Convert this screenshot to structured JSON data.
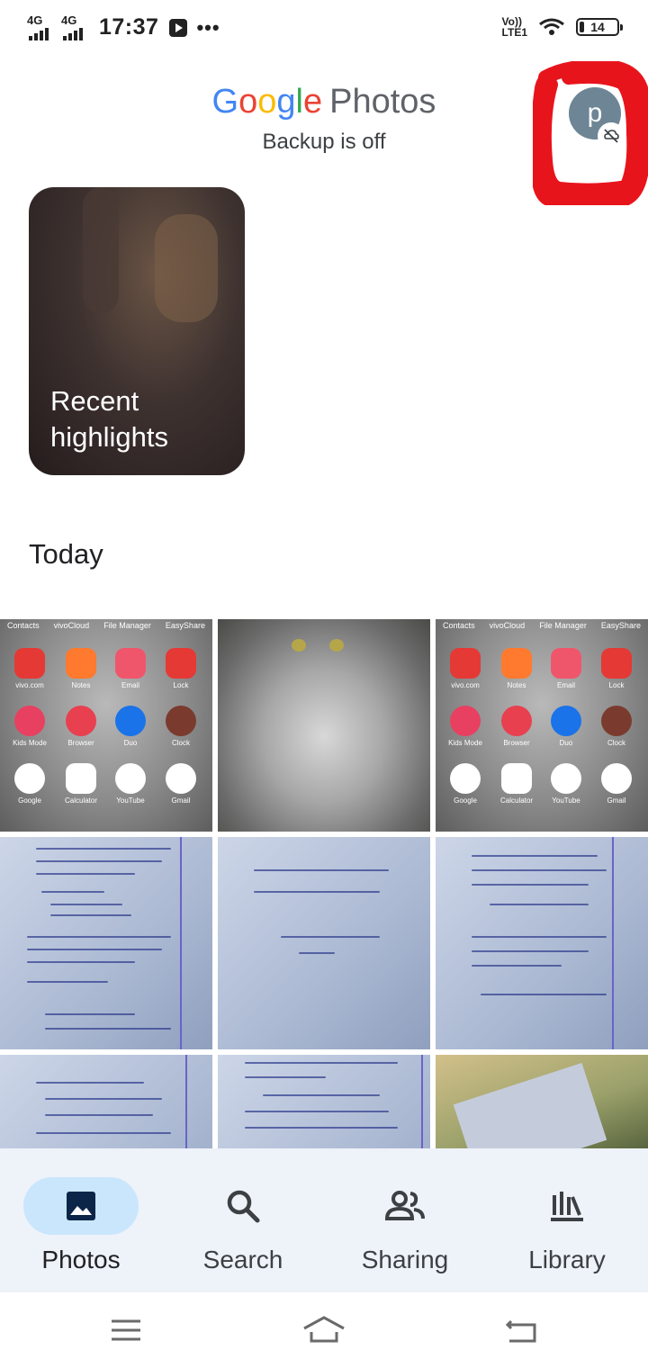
{
  "status_bar": {
    "signal1": "4G",
    "signal2": "4G",
    "time": "17:37",
    "more": "•••",
    "volte_line1": "Vo))",
    "volte_line2": "LTE1",
    "battery": "14"
  },
  "header": {
    "logo_letters": [
      "G",
      "o",
      "o",
      "g",
      "l",
      "e"
    ],
    "logo_product": "Photos",
    "backup_status": "Backup is off",
    "avatar_letter": "p"
  },
  "highlight": {
    "title": "Recent highlights"
  },
  "section": {
    "title": "Today"
  },
  "home_screen": {
    "top_labels": [
      "Contacts",
      "vivoCloud",
      "File Manager",
      "EasyShare"
    ],
    "app_labels": [
      "vivo.com",
      "Notes",
      "Email",
      "Lock",
      "Kids Mode",
      "Browser",
      "Duo",
      "Clock",
      "Google",
      "Calculator",
      "YouTube",
      "Gmail"
    ]
  },
  "bottom_nav": {
    "items": [
      {
        "label": "Photos",
        "icon": "photo-icon",
        "active": true
      },
      {
        "label": "Search",
        "icon": "search-icon",
        "active": false
      },
      {
        "label": "Sharing",
        "icon": "people-icon",
        "active": false
      },
      {
        "label": "Library",
        "icon": "library-icon",
        "active": false
      }
    ]
  },
  "colors": {
    "google_blue": "#4285F4",
    "google_red": "#EA4335",
    "google_yellow": "#FBBC05",
    "google_green": "#34A853",
    "nav_background": "#eef2f9",
    "active_pill": "#c9e6fc",
    "annotation_red": "#e8141c"
  }
}
